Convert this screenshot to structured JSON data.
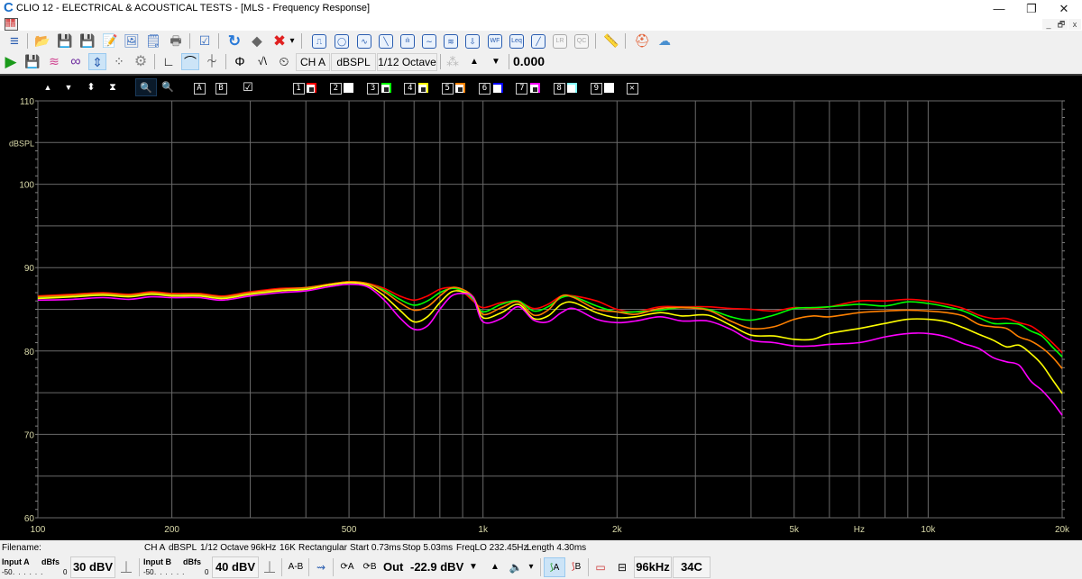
{
  "window": {
    "title": "CLIO 12 - ELECTRICAL & ACOUSTICAL TESTS - [MLS - Frequency Response]",
    "minimize": "—",
    "restore": "❐",
    "close": "✕",
    "mdi_minimize": "_",
    "mdi_restore": "🗗",
    "mdi_close": "x"
  },
  "toolbar1": {
    "items": [
      {
        "name": "menu-icon",
        "glyph": "≡"
      },
      {
        "name": "open-file-icon",
        "glyph": "📂"
      },
      {
        "name": "save-icon",
        "glyph": "💾"
      },
      {
        "name": "save-settings-icon",
        "glyph": "💾"
      },
      {
        "name": "save-notes-icon",
        "glyph": "📝"
      },
      {
        "name": "save-image-icon",
        "glyph": "🖼"
      },
      {
        "name": "notes-icon",
        "glyph": "🗒"
      },
      {
        "name": "print-icon",
        "glyph": "🖶"
      },
      {
        "name": "checklist-icon",
        "glyph": "☑"
      },
      {
        "name": "refresh-icon",
        "glyph": "↻"
      },
      {
        "name": "eraser-icon",
        "glyph": "⬥"
      },
      {
        "name": "delete-icon",
        "glyph": "✖"
      },
      {
        "name": "dropdown-arrow-icon",
        "glyph": "▾"
      }
    ],
    "analysis_buttons": [
      {
        "name": "mls-button",
        "glyph": "⎍"
      },
      {
        "name": "sinusoidal-button",
        "glyph": "◯"
      },
      {
        "name": "fft-button",
        "glyph": "∿"
      },
      {
        "name": "sweep-button",
        "glyph": "╲"
      },
      {
        "name": "waterfall-spectrum-button",
        "glyph": "ılı"
      },
      {
        "name": "sine-button",
        "glyph": "∼"
      },
      {
        "name": "polar-button",
        "glyph": "≋"
      },
      {
        "name": "thiele-small-button",
        "glyph": "⇩"
      },
      {
        "name": "wf-button",
        "glyph": "WF"
      },
      {
        "name": "leq-button",
        "glyph": "Leq"
      },
      {
        "name": "linearity-button",
        "glyph": "╱"
      },
      {
        "name": "lr-button",
        "glyph": "LR"
      },
      {
        "name": "qc-button",
        "glyph": "QC"
      }
    ],
    "ruler": "📏",
    "help": "⛑",
    "cloud_help": "☁"
  },
  "toolbar2": {
    "play": "▶",
    "save_ch": "💾",
    "multi_colors": "≋",
    "loop": "∞",
    "autoscale": "⇕",
    "dots": "⁘",
    "settings": "⚙",
    "time_window": "∟",
    "smoothing": "⌒",
    "phase": "⏆",
    "phi": "Φ",
    "minimum_phase": "√\\",
    "clock": "⏲",
    "channel": "CH A",
    "units": "dBSPL",
    "smoothing_value": "1/12 Octave",
    "snap": "⁂",
    "up": "▲",
    "down": "▼",
    "value": "0.000"
  },
  "chart_toolbar": {
    "up": "▲",
    "down": "▼",
    "expand": "⬍",
    "compress": "⧗",
    "zoom_in": "🔍",
    "zoom_out": "🔍",
    "marker_a": "A",
    "marker_b": "B",
    "overlay_check": "☑",
    "overlays": [
      {
        "key": "1",
        "color": "#ff0000",
        "enabled": true
      },
      {
        "key": "2",
        "color": "#ffffff",
        "enabled": false
      },
      {
        "key": "3",
        "color": "#00ff00",
        "enabled": true
      },
      {
        "key": "4",
        "color": "#ffff00",
        "enabled": true
      },
      {
        "key": "5",
        "color": "#ff8000",
        "enabled": true
      },
      {
        "key": "6",
        "color": "#0000ff",
        "enabled": false
      },
      {
        "key": "7",
        "color": "#ff00ff",
        "enabled": true
      },
      {
        "key": "8",
        "color": "#80ffff",
        "enabled": false
      },
      {
        "key": "9",
        "color": "#ffffff",
        "enabled": false
      }
    ],
    "clear": "✕"
  },
  "chart_data": {
    "type": "line",
    "title": "MLS - Frequency Response",
    "xlabel": "Hz",
    "ylabel": "dBSPL",
    "xscale": "log",
    "xlim": [
      100,
      20000
    ],
    "ylim": [
      60,
      110
    ],
    "grid": true,
    "legend": "none",
    "x_ticks": [
      {
        "value": 100,
        "label": "100"
      },
      {
        "value": 200,
        "label": "200"
      },
      {
        "value": 500,
        "label": "500"
      },
      {
        "value": 1000,
        "label": "1k"
      },
      {
        "value": 2000,
        "label": "2k"
      },
      {
        "value": 5000,
        "label": "5k"
      },
      {
        "value": 10000,
        "label": "10k"
      },
      {
        "value": 20000,
        "label": "20k"
      }
    ],
    "x_unit_label": {
      "value": 7000,
      "label": "Hz"
    },
    "x_grid": [
      100,
      200,
      300,
      400,
      500,
      600,
      700,
      800,
      900,
      1000,
      2000,
      3000,
      4000,
      5000,
      6000,
      7000,
      8000,
      9000,
      10000,
      20000
    ],
    "y_ticks": [
      {
        "value": 110,
        "label": "110"
      },
      {
        "value": 100,
        "label": "100"
      },
      {
        "value": 90,
        "label": "90"
      },
      {
        "value": 80,
        "label": "80"
      },
      {
        "value": 70,
        "label": "70"
      },
      {
        "value": 60,
        "label": "60"
      }
    ],
    "y_unit_label": {
      "value": 105,
      "label": "dBSPL"
    },
    "y_grid": [
      60,
      65,
      70,
      75,
      80,
      85,
      90,
      95,
      100,
      105,
      110
    ],
    "x": [
      100,
      120,
      140,
      160,
      180,
      200,
      230,
      260,
      300,
      350,
      400,
      450,
      500,
      550,
      600,
      650,
      700,
      750,
      800,
      850,
      900,
      950,
      1000,
      1100,
      1200,
      1300,
      1400,
      1500,
      1600,
      1800,
      2000,
      2200,
      2500,
      2800,
      3200,
      3600,
      4000,
      4500,
      5000,
      5500,
      6000,
      7000,
      8000,
      9000,
      10000,
      11000,
      12000,
      13000,
      14000,
      15000,
      16000,
      17000,
      18000,
      19000,
      20000
    ],
    "series": [
      {
        "name": "Overlay 1",
        "color": "#ff0000",
        "values": [
          86.6,
          86.8,
          87.0,
          86.8,
          87.1,
          86.9,
          86.9,
          86.6,
          87.1,
          87.5,
          87.6,
          88.0,
          88.3,
          88.1,
          87.5,
          86.6,
          86.1,
          86.6,
          87.4,
          87.6,
          87.1,
          86.0,
          85.2,
          85.8,
          85.9,
          85.1,
          85.6,
          86.6,
          86.6,
          86.0,
          85.0,
          84.7,
          85.3,
          85.3,
          85.3,
          85.1,
          85.0,
          84.8,
          85.2,
          85.1,
          85.3,
          86.0,
          86.0,
          86.2,
          86.0,
          85.6,
          85.1,
          84.3,
          83.9,
          83.9,
          83.4,
          83.0,
          82.1,
          81.0,
          79.8
        ]
      },
      {
        "name": "Overlay 3",
        "color": "#00ff00",
        "values": [
          86.4,
          86.6,
          86.8,
          86.6,
          86.9,
          86.7,
          86.7,
          86.4,
          86.9,
          87.3,
          87.5,
          87.9,
          88.2,
          88.0,
          87.3,
          86.2,
          85.5,
          86.0,
          87.0,
          87.5,
          87.2,
          86.2,
          84.7,
          85.6,
          86.0,
          84.8,
          85.3,
          86.4,
          86.5,
          85.4,
          84.7,
          84.7,
          84.9,
          85.2,
          85.0,
          84.1,
          83.7,
          84.3,
          85.1,
          85.2,
          85.3,
          85.6,
          85.4,
          85.9,
          85.7,
          85.3,
          84.8,
          84.0,
          83.3,
          83.3,
          83.2,
          82.4,
          81.8,
          80.5,
          79.3
        ]
      },
      {
        "name": "Overlay 5",
        "color": "#ff8000",
        "values": [
          86.5,
          86.7,
          86.9,
          86.7,
          87.0,
          86.8,
          86.8,
          86.5,
          87.0,
          87.4,
          87.6,
          88.0,
          88.3,
          88.1,
          87.1,
          85.8,
          84.9,
          85.3,
          86.6,
          87.6,
          87.4,
          86.5,
          84.4,
          85.2,
          85.9,
          84.3,
          84.9,
          86.6,
          86.4,
          85.0,
          84.7,
          84.4,
          85.1,
          85.2,
          84.9,
          83.6,
          82.7,
          82.9,
          83.8,
          84.2,
          84.1,
          84.6,
          84.8,
          84.9,
          84.8,
          84.6,
          84.2,
          83.2,
          82.9,
          82.7,
          81.7,
          81.2,
          80.4,
          79.3,
          77.9
        ]
      },
      {
        "name": "Overlay 4",
        "color": "#ffff00",
        "values": [
          86.3,
          86.5,
          86.7,
          86.5,
          86.8,
          86.6,
          86.6,
          86.3,
          86.8,
          87.2,
          87.4,
          87.9,
          88.2,
          87.9,
          86.6,
          84.9,
          83.5,
          84.1,
          85.8,
          87.1,
          87.1,
          86.4,
          84.0,
          84.6,
          85.6,
          83.9,
          84.2,
          85.6,
          85.8,
          84.6,
          84.0,
          84.1,
          84.6,
          84.2,
          84.3,
          83.1,
          81.9,
          81.8,
          81.4,
          81.4,
          82.1,
          82.7,
          83.3,
          83.8,
          83.8,
          83.5,
          82.8,
          82.0,
          81.3,
          80.5,
          80.7,
          79.7,
          78.4,
          76.6,
          74.9
        ]
      },
      {
        "name": "Overlay 7",
        "color": "#ff00ff",
        "values": [
          86.1,
          86.2,
          86.4,
          86.2,
          86.5,
          86.4,
          86.4,
          86.1,
          86.6,
          87.0,
          87.2,
          87.7,
          88.0,
          87.7,
          86.1,
          84.0,
          82.6,
          83.0,
          85.0,
          86.6,
          86.9,
          86.4,
          83.5,
          83.9,
          85.3,
          83.7,
          83.5,
          84.6,
          85.1,
          83.8,
          83.4,
          83.6,
          84.1,
          83.6,
          83.6,
          82.6,
          81.3,
          81.0,
          80.6,
          80.6,
          80.8,
          81.0,
          81.7,
          82.1,
          82.1,
          81.7,
          80.9,
          80.3,
          79.2,
          78.7,
          78.3,
          76.4,
          75.3,
          73.9,
          72.3
        ]
      }
    ]
  },
  "status": {
    "filename_label": "Filename:",
    "info": [
      "CH A",
      "dBSPL",
      "1/12 Octave",
      "96kHz",
      "16K",
      "Rectangular",
      "Start 0.73ms",
      "Stop 5.03ms",
      "FreqLO 232.45Hz",
      "Length 4.30ms"
    ],
    "input_a_label": "Input A",
    "input_a_units": "dBfs",
    "input_a_scale_min": "-50",
    "input_a_scale_max": "0",
    "input_a_range": "30 dBV",
    "input_b_label": "Input B",
    "input_b_units": "dBfs",
    "input_b_scale_min": "-50",
    "input_b_scale_max": "0",
    "input_b_range": "40 dBV",
    "a_minus_b": "A-B",
    "loop_a": "⟳A",
    "loop_b": "⟳B",
    "out_label": "Out",
    "out_level": "-22.9 dBV",
    "down": "▼",
    "up": "▲",
    "speaker": "🔈",
    "speaker_dropdown": "▾",
    "mic_a": "A",
    "mic_b": "B",
    "sample_rate": "96kHz",
    "temperature": "34C",
    "polarity_glyph": "⏊"
  }
}
